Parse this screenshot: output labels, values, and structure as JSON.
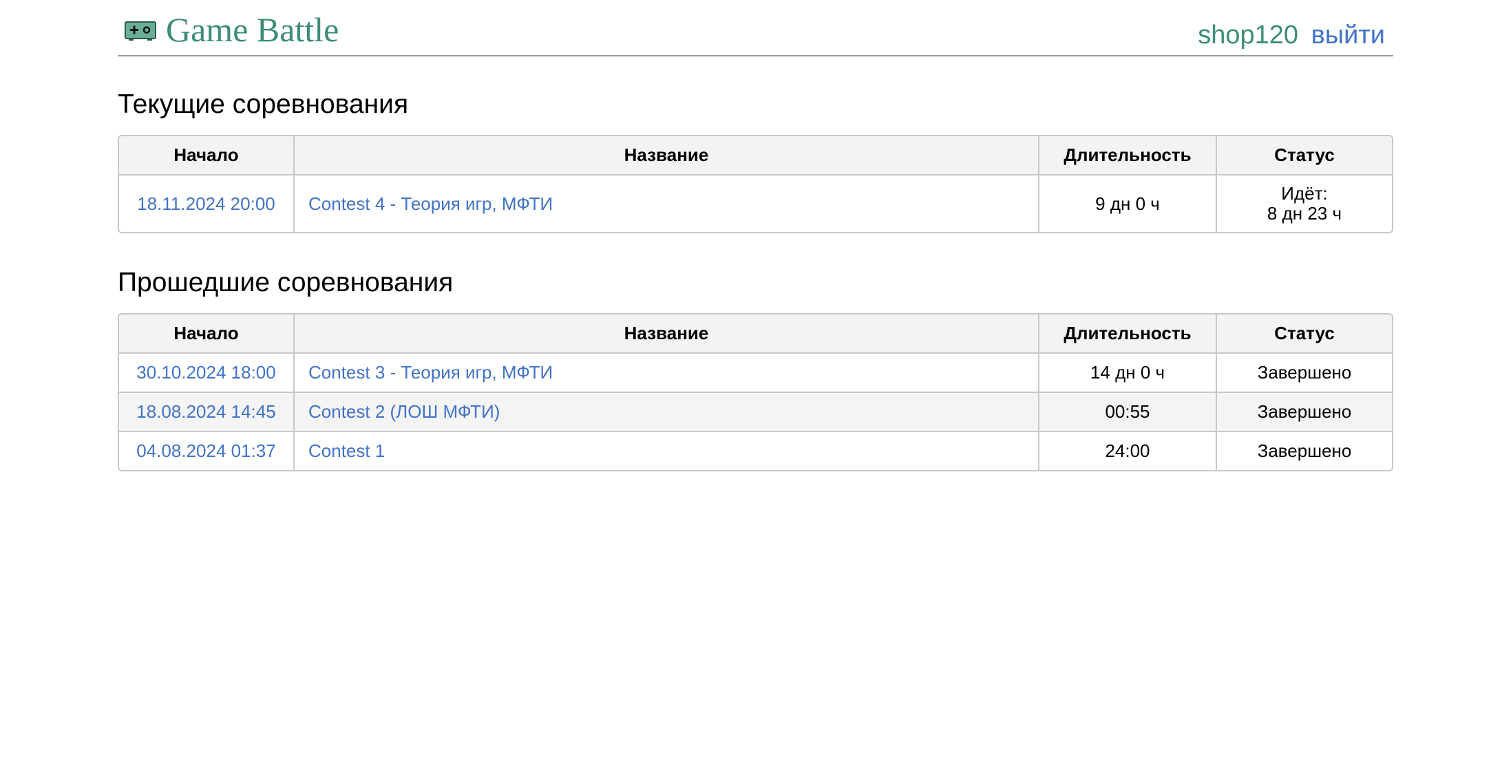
{
  "header": {
    "brand_title": "Game Battle",
    "username": "shop120",
    "logout_label": "выйти",
    "logo_icon": "gamepad-icon"
  },
  "columns": {
    "start": "Начало",
    "name": "Название",
    "duration": "Длительность",
    "status": "Статус"
  },
  "current": {
    "title": "Текущие соревнования",
    "rows": [
      {
        "start": "18.11.2024 20:00",
        "name": "Contest 4 - Теория игр, МФТИ",
        "duration": "9 дн 0 ч",
        "status_line1": "Идёт:",
        "status_line2": "8 дн 23 ч"
      }
    ]
  },
  "past": {
    "title": "Прошедшие соревнования",
    "rows": [
      {
        "start": "30.10.2024 18:00",
        "name": "Contest 3 - Теория игр, МФТИ",
        "duration": "14 дн 0 ч",
        "status": "Завершено"
      },
      {
        "start": "18.08.2024 14:45",
        "name": "Contest 2 (ЛОШ МФТИ)",
        "duration": "00:55",
        "status": "Завершено"
      },
      {
        "start": "04.08.2024 01:37",
        "name": "Contest 1",
        "duration": "24:00",
        "status": "Завершено"
      }
    ]
  },
  "colors": {
    "brand": "#3d8c78",
    "link": "#4173c7",
    "header_bg": "#f3f3f3",
    "border": "#c8c8c8"
  }
}
